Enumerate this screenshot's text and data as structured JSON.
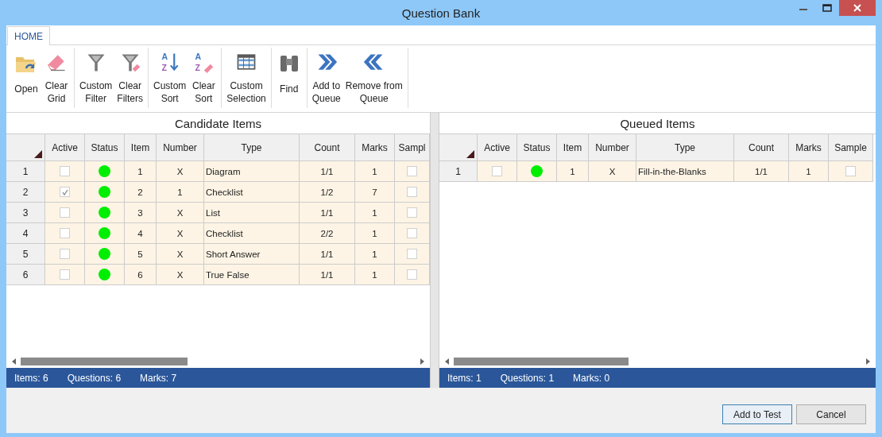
{
  "window": {
    "title": "Question Bank"
  },
  "tabs": [
    {
      "label": "HOME",
      "selected": true
    }
  ],
  "ribbon": {
    "groups": [
      {
        "buttons": [
          {
            "label": "Open",
            "kind": "open"
          },
          {
            "label": "Clear\nGrid",
            "kind": "eraser"
          }
        ]
      },
      {
        "buttons": [
          {
            "label": "Custom\nFilter",
            "kind": "filter"
          },
          {
            "label": "Clear\nFilters",
            "kind": "filter-clear"
          }
        ]
      },
      {
        "buttons": [
          {
            "label": "Custom\nSort",
            "kind": "sort",
            "glyphs": [
              "A",
              "Z"
            ]
          },
          {
            "label": "Clear\nSort",
            "kind": "sort-clear",
            "glyphs": [
              "A",
              "Z"
            ]
          }
        ]
      },
      {
        "buttons": [
          {
            "label": "Custom\nSelection",
            "kind": "grid"
          }
        ]
      },
      {
        "buttons": [
          {
            "label": "Find",
            "kind": "binoculars"
          }
        ]
      },
      {
        "buttons": [
          {
            "label": "Add to\nQueue",
            "kind": "right"
          },
          {
            "label": "Remove from\nQueue",
            "kind": "left"
          }
        ]
      }
    ]
  },
  "panels": [
    {
      "title": "Candidate Items",
      "columns": [
        "Active",
        "Status",
        "Item",
        "Number",
        "Type",
        "Count",
        "Marks",
        "Sampl"
      ],
      "rows": [
        {
          "row": "1",
          "active": false,
          "color": "#00ee00",
          "item": "1",
          "number": "X",
          "type": "Diagram",
          "count": "1/1",
          "marks": "1",
          "sample": false
        },
        {
          "row": "2",
          "active": true,
          "color": "#00ee00",
          "item": "2",
          "number": "1",
          "type": "Checklist",
          "count": "1/2",
          "marks": "7",
          "sample": false
        },
        {
          "row": "3",
          "active": false,
          "color": "#00ee00",
          "item": "3",
          "number": "X",
          "type": "List",
          "count": "1/1",
          "marks": "1",
          "sample": false
        },
        {
          "row": "4",
          "active": false,
          "color": "#00ee00",
          "item": "4",
          "number": "X",
          "type": "Checklist",
          "count": "2/2",
          "marks": "1",
          "sample": false
        },
        {
          "row": "5",
          "active": false,
          "color": "#00ee00",
          "item": "5",
          "number": "X",
          "type": "Short Answer",
          "count": "1/1",
          "marks": "1",
          "sample": false
        },
        {
          "row": "6",
          "active": false,
          "color": "#00ee00",
          "item": "6",
          "number": "X",
          "type": "True False",
          "count": "1/1",
          "marks": "1",
          "sample": false
        }
      ],
      "status": [
        "Items: 6",
        "Questions: 6",
        "Marks: 7"
      ]
    },
    {
      "title": "Queued Items",
      "columns": [
        "Active",
        "Status",
        "Item",
        "Number",
        "Type",
        "Count",
        "Marks",
        "Sample"
      ],
      "rows": [
        {
          "row": "1",
          "active": false,
          "color": "#00ee00",
          "item": "1",
          "number": "X",
          "type": "Fill-in-the-Blanks",
          "count": "1/1",
          "marks": "1",
          "sample": false
        }
      ],
      "status": [
        "Items: 1",
        "Questions: 1",
        "Marks: 0"
      ]
    }
  ],
  "buttons": [
    {
      "label": "Add to Test",
      "selected": true
    },
    {
      "label": "Cancel",
      "selected": false
    }
  ]
}
